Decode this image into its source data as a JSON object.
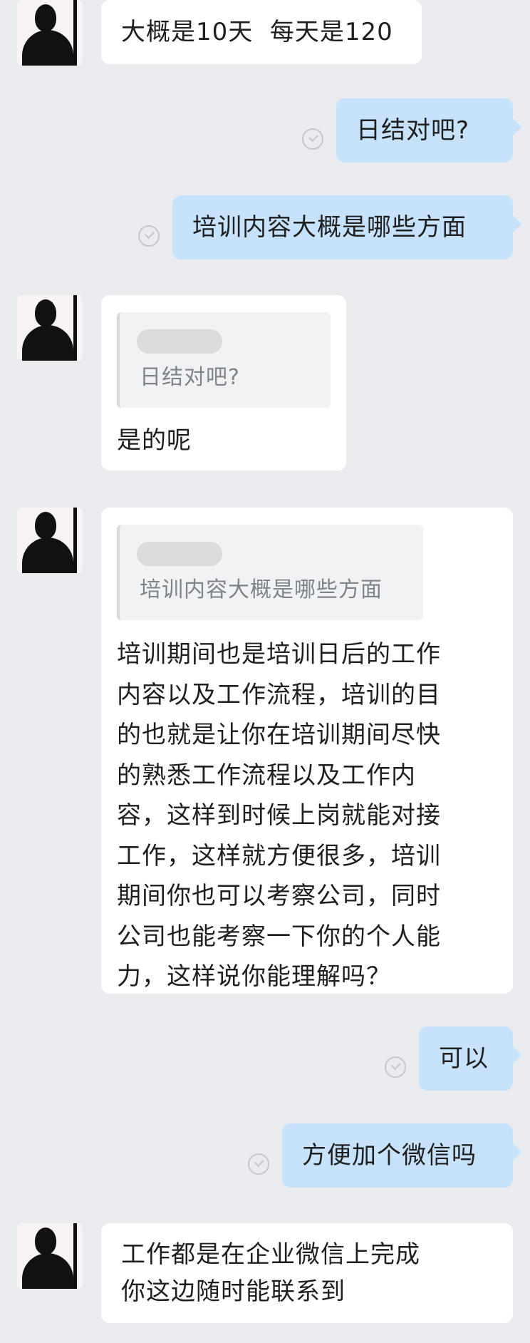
{
  "messages": [
    {
      "text": "大概是10天  每天是120"
    },
    {
      "text": "日结对吧?"
    },
    {
      "text": "培训内容大概是哪些方面"
    },
    {
      "quote": "日结对吧?",
      "text": "是的呢"
    },
    {
      "quote": "培训内容大概是哪些方面",
      "text": "培训期间也是培训日后的工作\n内容以及工作流程，培训的目\n的也就是让你在培训期间尽快\n的熟悉工作流程以及工作内\n容，这样到时候上岗就能对接\n工作，这样就方便很多，培训\n期间你也可以考察公司，同时\n公司也能考察一下你的个人能\n力，这样说你能理解吗？"
    },
    {
      "text": "可以"
    },
    {
      "text": "方便加个微信吗"
    },
    {
      "text": "工作都是在企业微信上完成\n你这边随时能联系到"
    }
  ],
  "icons": {
    "avatar": "silhouette-avatar-icon",
    "read": "read-receipt-check-icon"
  }
}
